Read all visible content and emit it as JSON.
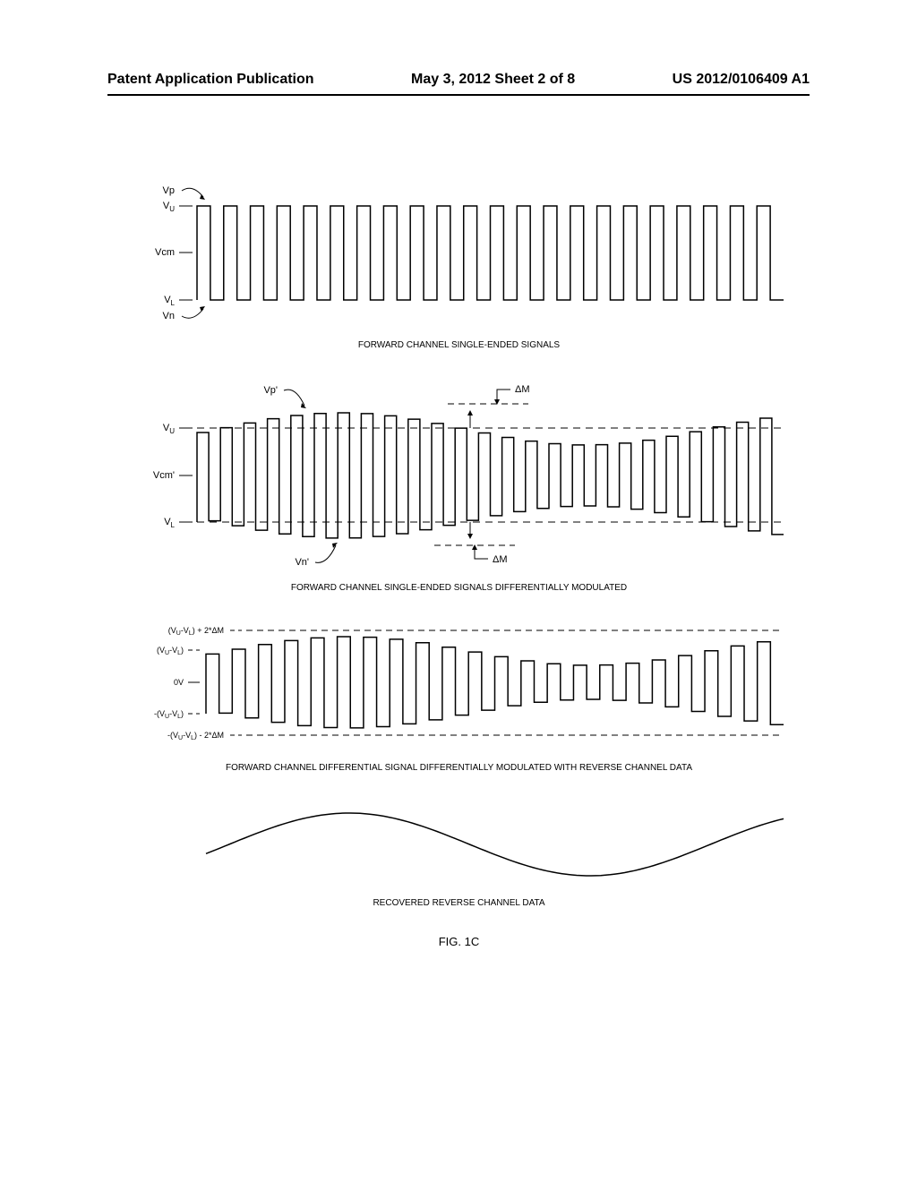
{
  "header": {
    "left": "Patent Application Publication",
    "center": "May 3, 2012  Sheet 2 of 8",
    "right": "US 2012/0106409 A1"
  },
  "chart1": {
    "title": "FORWARD CHANNEL SINGLE-ENDED SIGNALS",
    "labels": {
      "vu": "V",
      "vu_sub": "U",
      "vcm": "Vcm",
      "vl": "V",
      "vl_sub": "L",
      "vp": "Vp",
      "vn": "Vn"
    }
  },
  "chart2": {
    "title": "FORWARD CHANNEL SINGLE-ENDED SIGNALS DIFFERENTIALLY MODULATED",
    "labels": {
      "vu": "V",
      "vu_sub": "U",
      "vcm": "Vcm'",
      "vl": "V",
      "vl_sub": "L",
      "vp": "Vp'",
      "vn": "Vn'",
      "dm": "ΔM"
    }
  },
  "chart3": {
    "title": "FORWARD CHANNEL DIFFERENTIAL SIGNAL DIFFERENTIALLY MODULATED WITH REVERSE CHANNEL DATA",
    "labels": {
      "l1": "(V",
      "l1_sub1": "U",
      "l1_mid": "-V",
      "l1_sub2": "L",
      "l1_end": ") + 2*ΔM",
      "l2": "(V",
      "l2_end": ")",
      "l3": "0V",
      "l4": "-(V",
      "l4_end": ")",
      "l5": "-(V",
      "l5_end": ") - 2*ΔM"
    }
  },
  "chart4": {
    "title": "RECOVERED REVERSE CHANNEL DATA"
  },
  "figure_label": "FIG. 1C",
  "chart_data": {
    "type": "line",
    "description": "Four stacked signal waveform diagrams showing differential modulation",
    "chart1": {
      "type": "square_wave",
      "levels": [
        "Vp",
        "VU",
        "Vcm",
        "VL",
        "Vn"
      ],
      "description": "Clean square wave oscillating between VU and VL with annotations Vp (peak) and Vn (trough)"
    },
    "chart2": {
      "type": "modulated_square_wave",
      "levels": [
        "Vp'",
        "VU",
        "Vcm'",
        "VL",
        "Vn'"
      ],
      "modulation": "ΔM",
      "description": "Square wave with amplitude modulated by slow sine envelope ±ΔM, dashed lines at VU and VL baselines"
    },
    "chart3": {
      "type": "differential_square_wave",
      "levels": [
        "(VU-VL)+2*ΔM",
        "(VU-VL)",
        "0V",
        "-(VU-VL)",
        "-(VU-VL)-2*ΔM"
      ],
      "description": "Differential signal oscillating with envelope, dashed bounds at ±(VU-VL)±2ΔM"
    },
    "chart4": {
      "type": "sine",
      "description": "Recovered slow sine wave (reverse channel data envelope)"
    }
  }
}
